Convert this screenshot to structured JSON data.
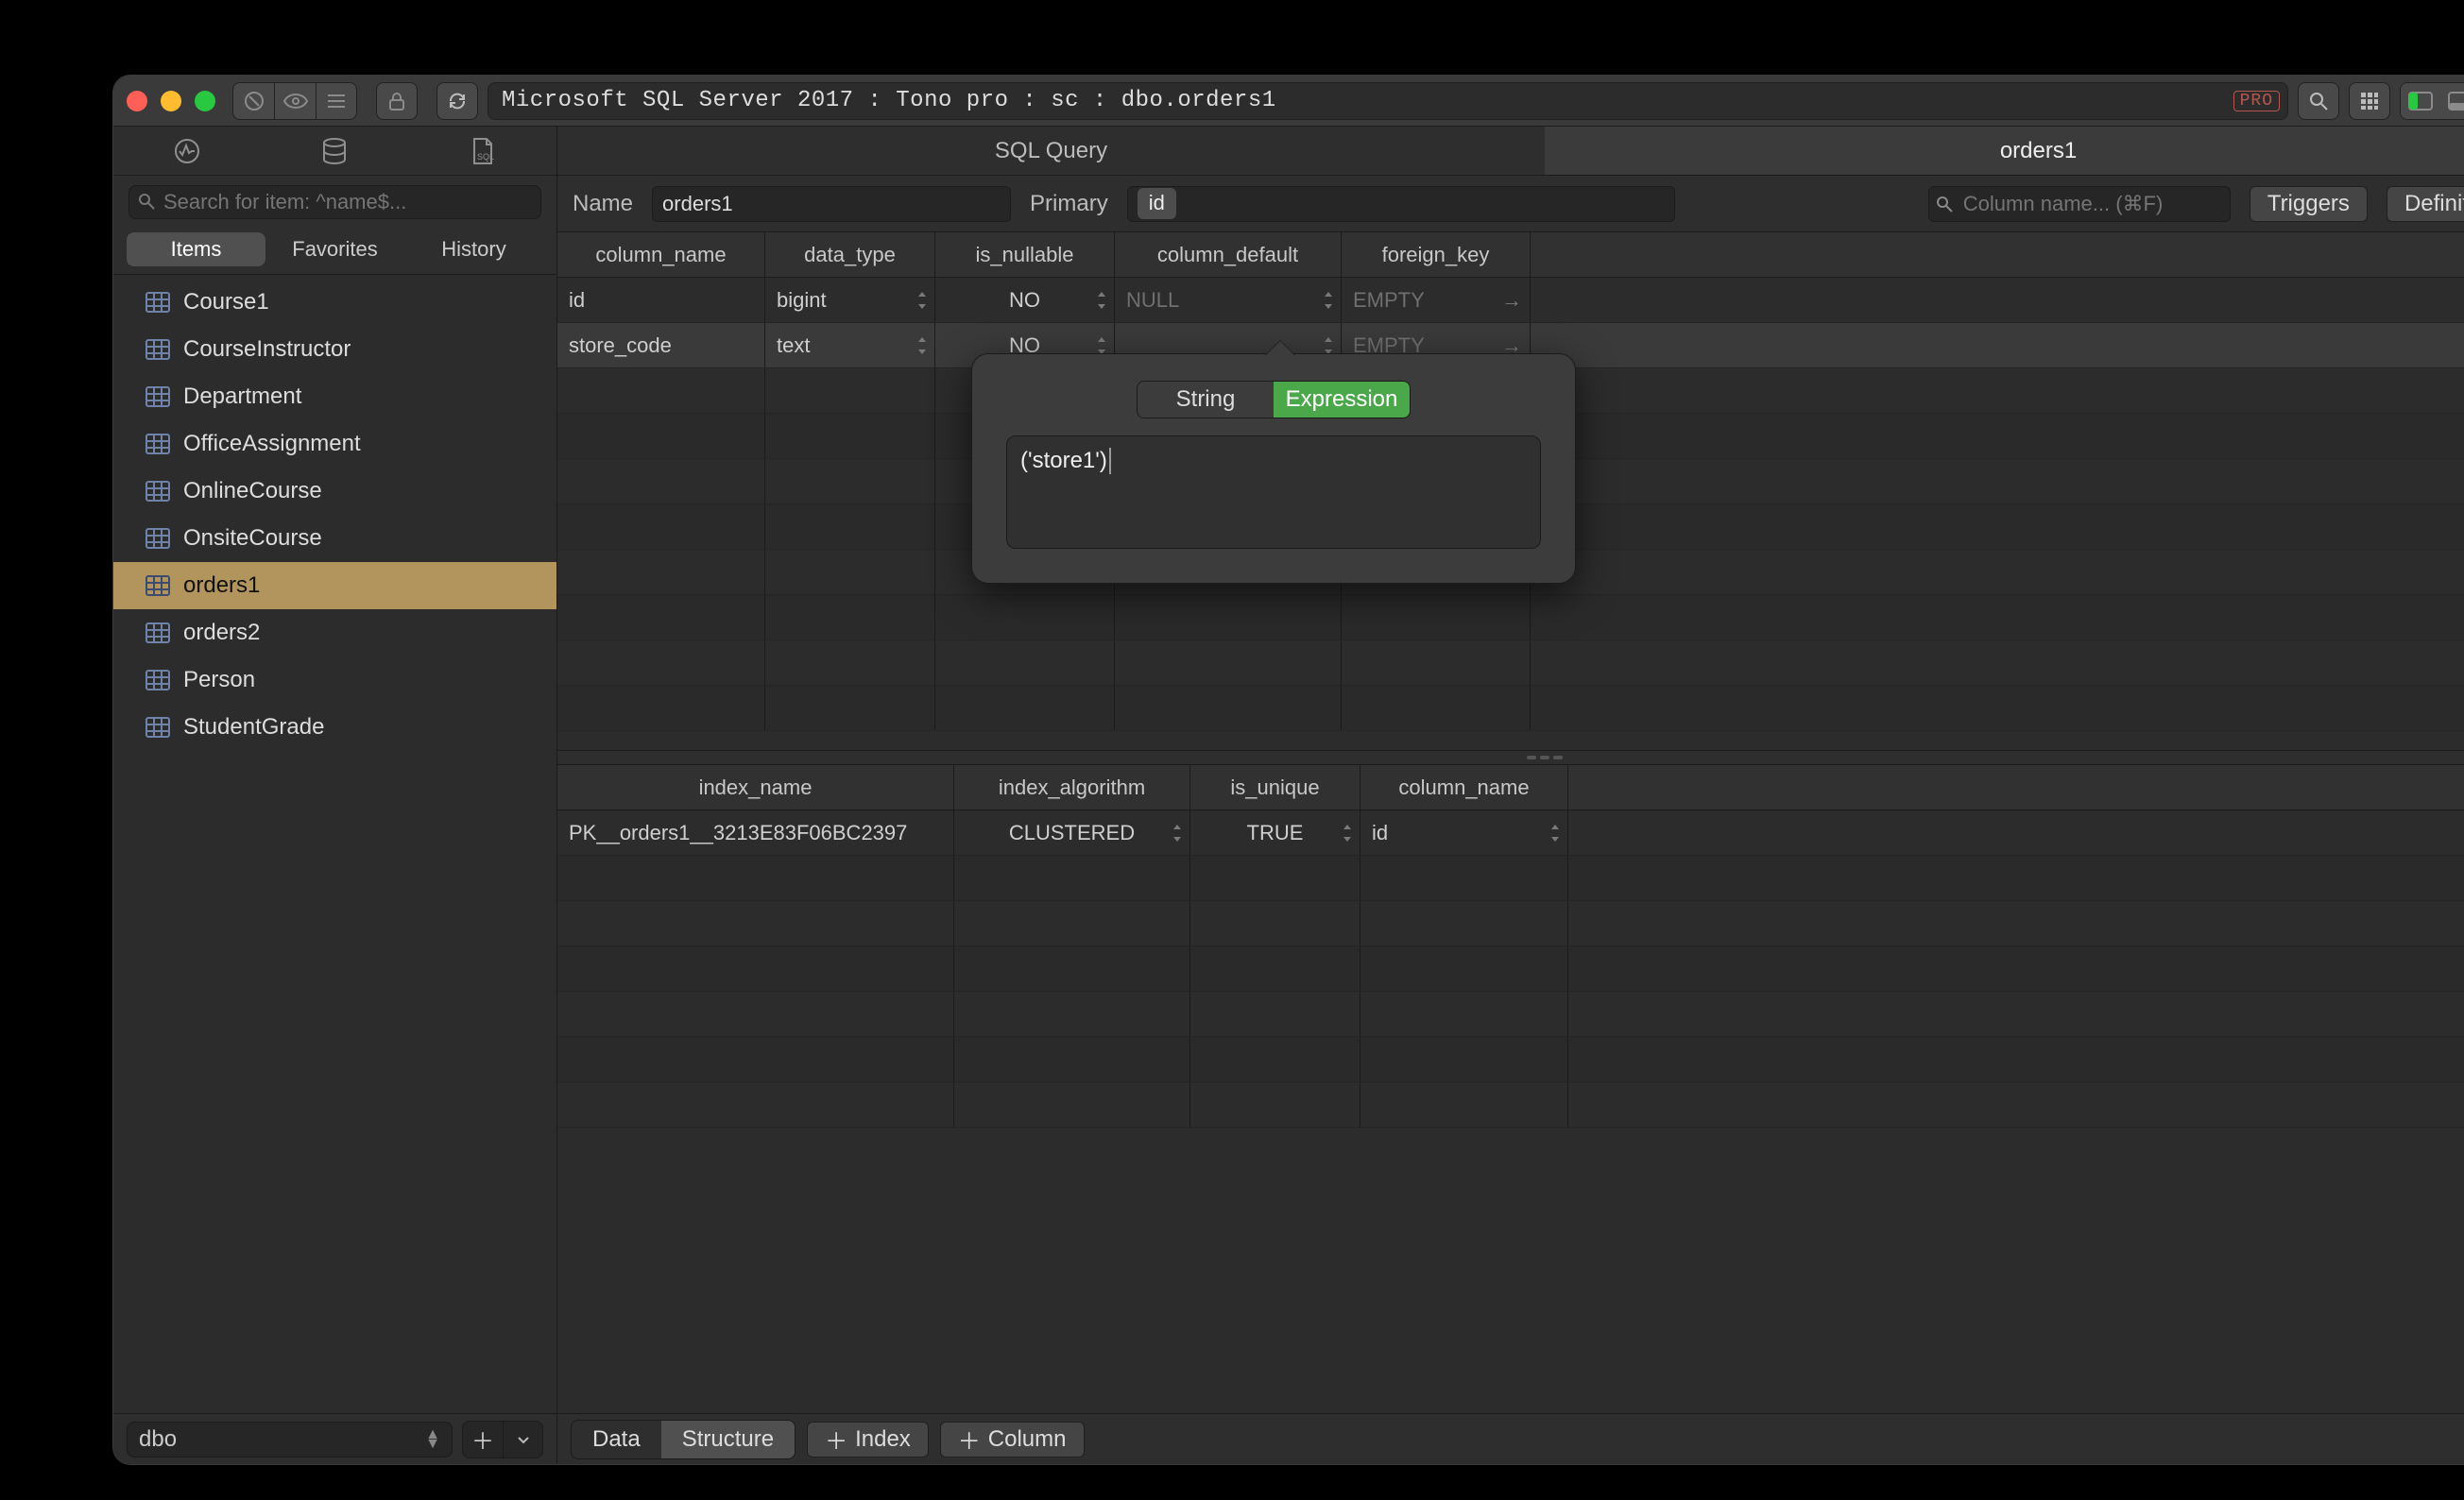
{
  "titlebar": {
    "path": "Microsoft SQL Server 2017 : Tono pro : sc : dbo.orders1",
    "pro_badge": "PRO"
  },
  "sidebar": {
    "search_placeholder": "Search for item: ^name$...",
    "segs": [
      "Items",
      "Favorites",
      "History"
    ],
    "items": [
      {
        "label": "Course1"
      },
      {
        "label": "CourseInstructor"
      },
      {
        "label": "Department"
      },
      {
        "label": "OfficeAssignment"
      },
      {
        "label": "OnlineCourse"
      },
      {
        "label": "OnsiteCourse"
      },
      {
        "label": "orders1"
      },
      {
        "label": "orders2"
      },
      {
        "label": "Person"
      },
      {
        "label": "StudentGrade"
      }
    ],
    "active_index": 6,
    "schema": "dbo"
  },
  "main_tabs": {
    "items": [
      "SQL Query",
      "orders1"
    ],
    "active_index": 1
  },
  "structure": {
    "name_label": "Name",
    "name_value": "orders1",
    "primary_label": "Primary",
    "primary_value": "id",
    "column_search_placeholder": "Column name... (⌘F)",
    "triggers_btn": "Triggers",
    "definition_btn": "Definition",
    "columns_header": [
      "column_name",
      "data_type",
      "is_nullable",
      "column_default",
      "foreign_key"
    ],
    "columns": [
      {
        "name": "id",
        "type": "bigint",
        "nullable": "NO",
        "default": "NULL",
        "fk": "EMPTY"
      },
      {
        "name": "store_code",
        "type": "text",
        "nullable": "NO",
        "default": "('store1')",
        "fk": "EMPTY"
      }
    ],
    "indexes_header": [
      "index_name",
      "index_algorithm",
      "is_unique",
      "column_name"
    ],
    "indexes": [
      {
        "name": "PK__orders1__3213E83F06BC2397",
        "alg": "CLUSTERED",
        "unique": "TRUE",
        "column": "id"
      }
    ]
  },
  "popover": {
    "segs": [
      "String",
      "Expression"
    ],
    "active": 1,
    "value": "('store1')"
  },
  "bottombar": {
    "mode_data": "Data",
    "mode_structure": "Structure",
    "btn_index": "Index",
    "btn_column": "Column"
  }
}
